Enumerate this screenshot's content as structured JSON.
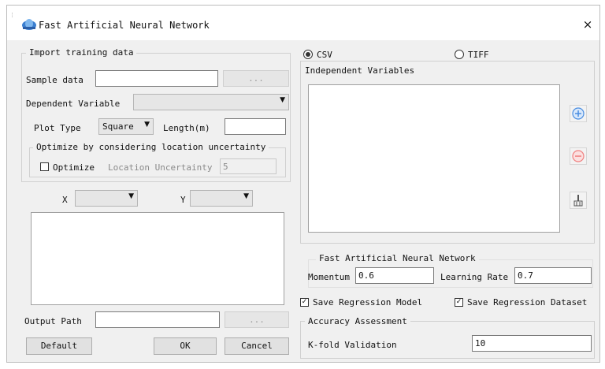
{
  "window": {
    "title": "Fast Artificial Neural Network",
    "close_glyph": "×"
  },
  "import": {
    "group_title": "Import training data",
    "sample_label": "Sample data",
    "sample_value": "",
    "browse_label": "...",
    "dependent_label": "Dependent Variable",
    "dependent_value": "",
    "plot_type_label": "Plot Type",
    "plot_type_value": "Square",
    "length_label": "Length(m)",
    "length_value": ""
  },
  "optimize": {
    "group_title": "Optimize by considering location uncertainty",
    "checkbox_label": "Optimize",
    "checked": false,
    "uncertainty_label": "Location Uncertainty",
    "uncertainty_value": "5"
  },
  "coords": {
    "x_label": "X",
    "x_value": "",
    "y_label": "Y",
    "y_value": ""
  },
  "output": {
    "label": "Output Path",
    "value": "",
    "browse_label": "..."
  },
  "buttons": {
    "default": "Default",
    "ok": "OK",
    "cancel": "Cancel"
  },
  "format": {
    "csv_label": "CSV",
    "tiff_label": "TIFF",
    "selected": "CSV"
  },
  "independent": {
    "title": "Independent Variables"
  },
  "side_icons": [
    "add-icon",
    "remove-icon",
    "clear-brush-icon"
  ],
  "fann": {
    "group_title": "Fast Artificial Neural Network",
    "momentum_label": "Momentum",
    "momentum_value": "0.6",
    "learning_label": "Learning Rate",
    "learning_value": "0.7"
  },
  "save": {
    "model_label": "Save Regression Model",
    "model_checked": true,
    "dataset_label": "Save Regression Dataset",
    "dataset_checked": true
  },
  "accuracy": {
    "group_title": "Accuracy Assessment",
    "kfold_label": "K-fold Validation",
    "kfold_value": "10"
  },
  "colors": {
    "accent_blue": "#4a8de0",
    "disabled_red": "#f08080",
    "window_bg": "#f0f0f0"
  }
}
